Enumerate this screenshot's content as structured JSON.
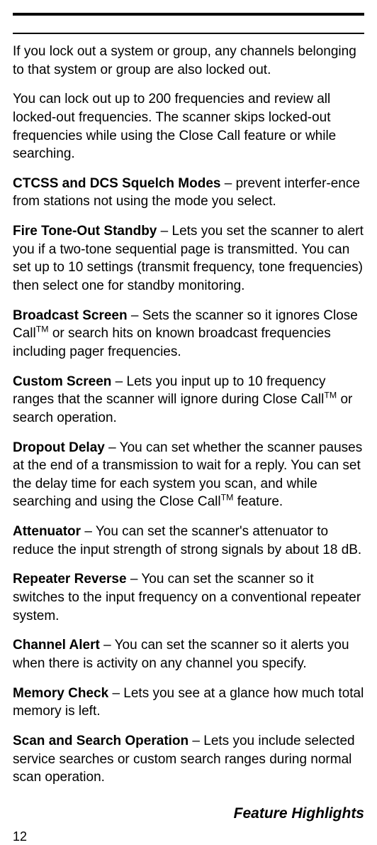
{
  "intro1": "If you lock out a system or group, any channels belonging to that system or group are also locked out.",
  "intro2": "You can lock out up to 200 frequencies and review all locked-out frequencies. The scanner skips locked-out frequencies while using the Close Call feature or while searching.",
  "features": {
    "ctcss": {
      "title": "CTCSS and DCS Squelch Modes",
      "body": " – prevent interfer-ence from stations not using the mode you select."
    },
    "fire": {
      "title": "Fire Tone-Out Standby",
      "body": " – Lets you set the scanner to alert you if a two-tone sequential page is transmitted. You can set up to 10 settings (transmit frequency, tone frequencies) then select one for standby monitoring."
    },
    "broadcast": {
      "title": "Broadcast Screen",
      "pre": " – Sets the scanner so it ignores Close Call",
      "tm": "TM",
      "post": " or search hits on known broadcast frequencies including pager frequencies."
    },
    "custom": {
      "title": "Custom Screen",
      "pre": " – Lets you input up to 10 frequency ranges that the scanner will ignore during Close Call",
      "tm": "TM",
      "post": " or search operation."
    },
    "dropout": {
      "title": "Dropout Delay",
      "pre": " – You can set whether the scanner pauses at the end of a transmission to wait for a reply. You can set the delay time for each system you scan, and while searching and using the Close Call",
      "tm": "TM",
      "post": " feature."
    },
    "attenuator": {
      "title": "Attenuator",
      "body": " – You can set the scanner's attenuator to reduce the input strength of strong signals by about 18 dB."
    },
    "repeater": {
      "title": "Repeater Reverse",
      "body": " – You can set the scanner so it switches to the input frequency on a conventional repeater system."
    },
    "channel": {
      "title": "Channel Alert",
      "body": " – You can set the scanner so it alerts you when there is activity on any channel you specify."
    },
    "memory": {
      "title": "Memory Check",
      "body": " – Lets you see at a glance how much total memory is left."
    },
    "scan": {
      "title": "Scan and Search Operation",
      "body": " – Lets you include selected service searches or custom search ranges during normal scan operation."
    }
  },
  "footer_title": "Feature Highlights",
  "page_number": "12"
}
